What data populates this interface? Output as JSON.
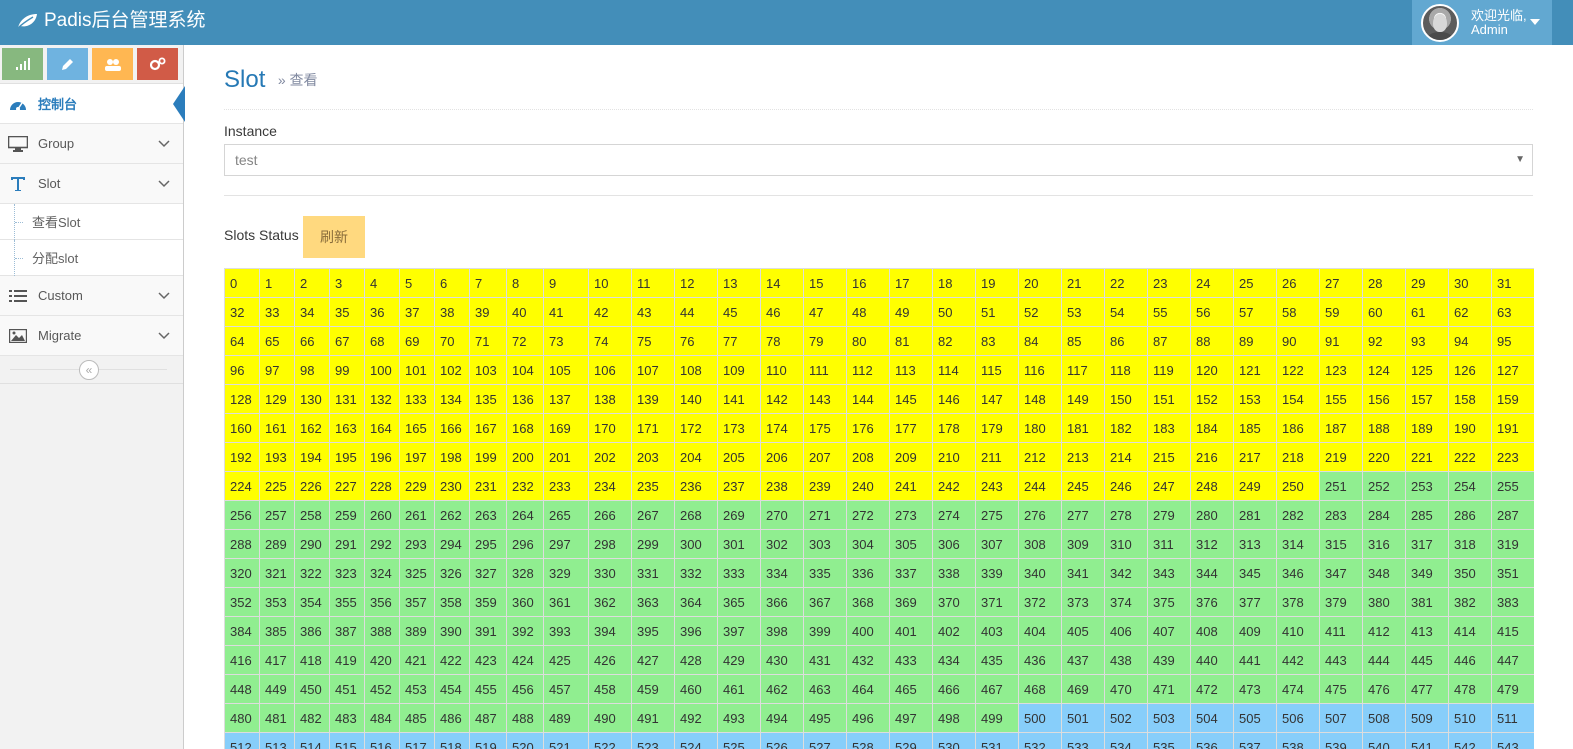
{
  "app": {
    "title": "Padis后台管理系统"
  },
  "user": {
    "greeting": "欢迎光临,",
    "name": "Admin"
  },
  "colors": {
    "navbar": "#438eb9",
    "assigned_a": "#ffff00",
    "assigned_b": "#90ee90",
    "assigned_c": "#87cefa",
    "accent": "#2b7dbc"
  },
  "shortcuts": [
    {
      "icon": "signal-icon",
      "color": "#87b87f"
    },
    {
      "icon": "pencil-icon",
      "color": "#6fb3e0"
    },
    {
      "icon": "users-icon",
      "color": "#ffb752"
    },
    {
      "icon": "cogs-icon",
      "color": "#d15b47"
    }
  ],
  "sidebar": {
    "items": [
      {
        "label": "控制台",
        "icon": "dashboard-icon",
        "active": true
      },
      {
        "label": "Group",
        "icon": "desktop-icon"
      },
      {
        "label": "Slot",
        "icon": "text-icon",
        "open": true,
        "children": [
          {
            "label": "查看Slot"
          },
          {
            "label": "分配slot"
          }
        ]
      },
      {
        "label": "Custom",
        "icon": "list-icon"
      },
      {
        "label": "Migrate",
        "icon": "picture-icon"
      }
    ]
  },
  "page": {
    "title": "Slot",
    "subtitle": "» 查看",
    "instance_label": "Instance",
    "instance_value": "test",
    "status_label": "Slots Status",
    "refresh_label": "刷新"
  },
  "slots": {
    "columns": 32,
    "last_visible": 543,
    "ranges": [
      {
        "from": 0,
        "to": 250,
        "color": "#ffff00"
      },
      {
        "from": 251,
        "to": 499,
        "color": "#90ee90"
      },
      {
        "from": 500,
        "to": 543,
        "color": "#87cefa"
      }
    ]
  }
}
